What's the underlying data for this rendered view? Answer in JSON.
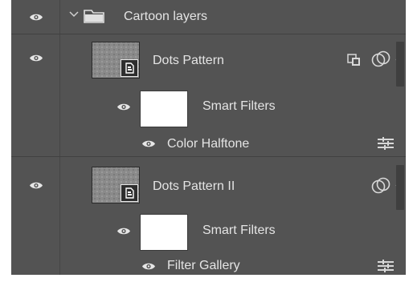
{
  "group": {
    "name": "Cartoon layers"
  },
  "layers": [
    {
      "name": "Dots Pattern",
      "smart_filters_label": "Smart Filters",
      "filter_name": "Color Halftone"
    },
    {
      "name": "Dots Pattern II",
      "smart_filters_label": "Smart Filters",
      "filter_name": "Filter Gallery"
    }
  ],
  "icons": {
    "eye": "eye-icon",
    "chevron": "chevron-down-icon",
    "folder": "folder-icon",
    "smart_object": "smart-object-icon",
    "link": "linked-icon",
    "effects": "effects-icon",
    "filter_options": "filter-options-icon"
  },
  "colors": {
    "panel_bg": "#535353",
    "text": "#e4e4e4"
  }
}
